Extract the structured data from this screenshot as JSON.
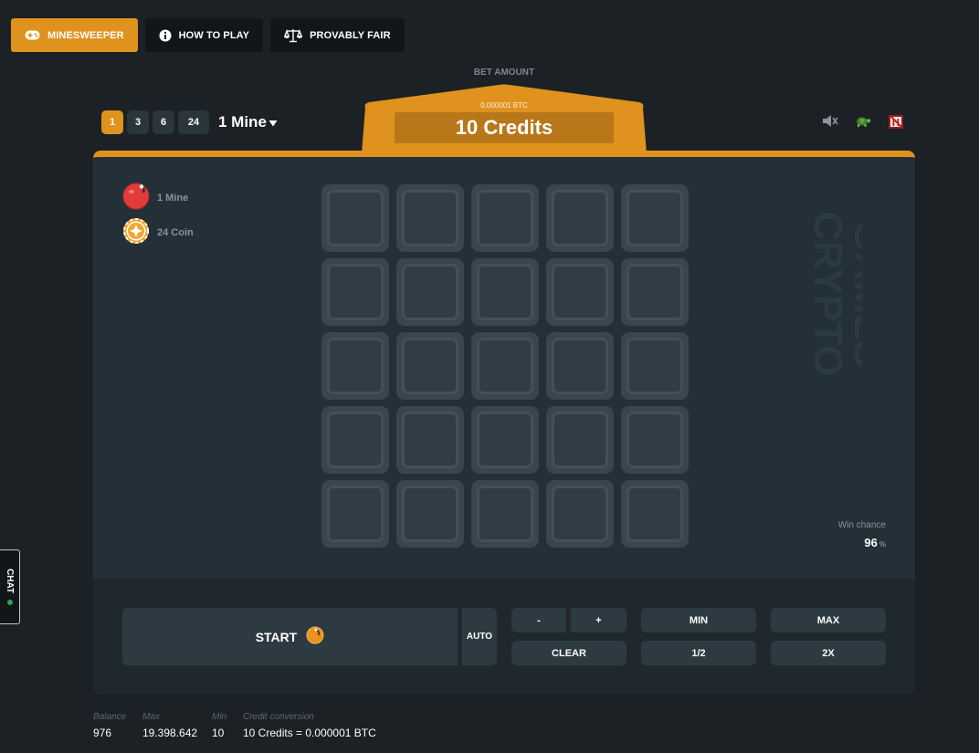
{
  "tabs": [
    {
      "label": "MINESWEEPER",
      "icon": "gamepad-icon",
      "active": true
    },
    {
      "label": "HOW TO PLAY",
      "icon": "info-icon",
      "active": false
    },
    {
      "label": "PROVABLY FAIR",
      "icon": "scale-icon",
      "active": false
    }
  ],
  "bet": {
    "label": "BET AMOUNT",
    "btc": "0,000001 BTC",
    "credits": "10 Credits"
  },
  "mines_selector": {
    "options": [
      "1",
      "3",
      "6",
      "24"
    ],
    "selected": "1",
    "dropdown_label": "1 Mine"
  },
  "top_icons": [
    "sound-icon",
    "turtle-icon",
    "no-animation-icon"
  ],
  "legend": {
    "mines": "1 Mine",
    "coins": "24 Coin"
  },
  "grid": {
    "rows": 5,
    "cols": 5
  },
  "watermark": [
    "CRYPTO",
    "GAMES"
  ],
  "win_chance": {
    "label": "Win chance",
    "value": "96",
    "unit": "%"
  },
  "controls": {
    "start": "START",
    "auto": "AUTO",
    "minus": "-",
    "plus": "+",
    "min": "MIN",
    "max": "MAX",
    "clear": "CLEAR",
    "half": "1/2",
    "double": "2X"
  },
  "stats": [
    {
      "label": "Balance",
      "value": "976"
    },
    {
      "label": "Max",
      "value": "19.398.642"
    },
    {
      "label": "Min",
      "value": "10"
    },
    {
      "label": "Credit conversion",
      "value": "10 Credits = 0.000001 BTC"
    }
  ],
  "chat": {
    "label": "CHAT"
  },
  "colors": {
    "accent": "#e0921e",
    "background": "#1b2124",
    "panel": "#233038",
    "online": "#2ea44f"
  }
}
